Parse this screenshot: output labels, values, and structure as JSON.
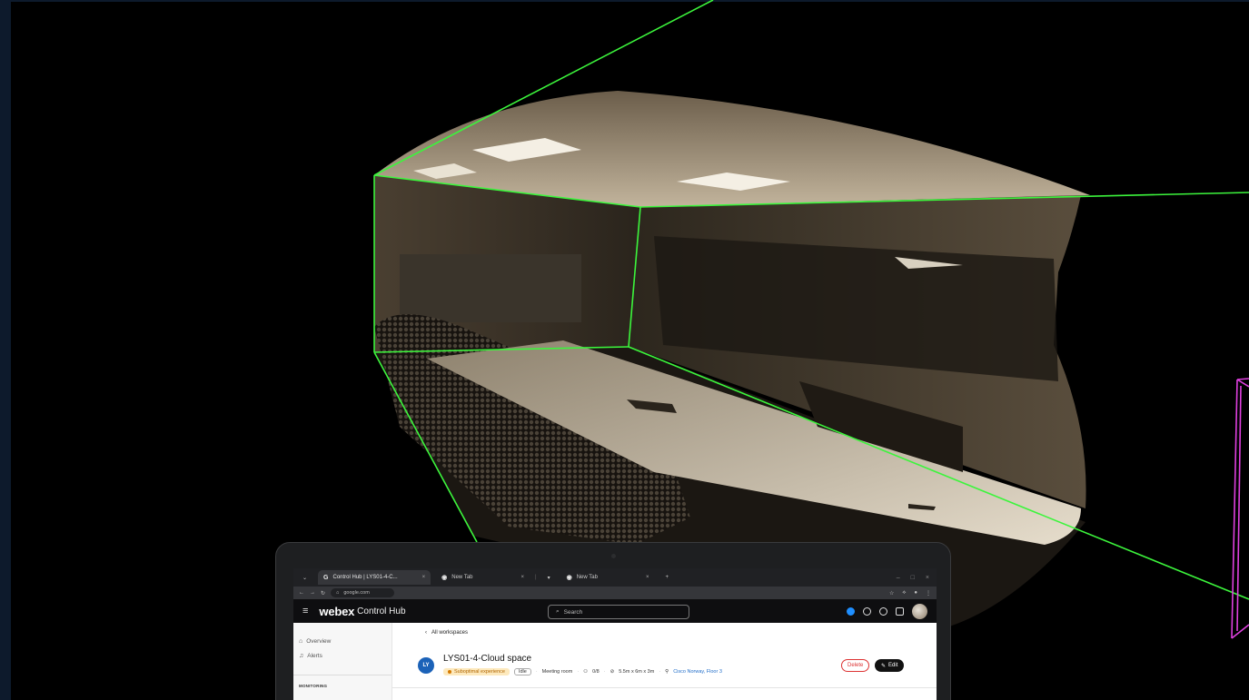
{
  "browser": {
    "tabs": [
      {
        "label": "Control Hub | LYS01-4-C...",
        "icon": "google-g-icon"
      },
      {
        "label": "New Tab",
        "icon": "google-g-icon"
      },
      {
        "label": "New Tab",
        "icon": "google-g-icon"
      }
    ],
    "url": "google.com"
  },
  "app": {
    "brand": "webex",
    "brand_sub": "Control Hub",
    "search_placeholder": "Search"
  },
  "sidebar": {
    "items": [
      {
        "label": "Overview",
        "icon": "home-icon"
      },
      {
        "label": "Alerts",
        "icon": "bell-icon"
      }
    ],
    "section": "MONITORING"
  },
  "workspace": {
    "back_label": "All workspaces",
    "initials": "LY",
    "title": "LYS01-4-Cloud space",
    "status": "Suboptimal experience",
    "state": "Idle",
    "type": "Meeting room",
    "capacity": "0/8",
    "dimensions": "5.5m x 6m x 3m",
    "location": "Cisco Norway, Floor 3",
    "delete_label": "Delete",
    "edit_label": "Edit"
  },
  "colors": {
    "room_box": "#3cf53c",
    "secondary_box": "#e040e0",
    "accent_blue": "#1f6cc9",
    "warn_bg": "#fde9bd"
  }
}
